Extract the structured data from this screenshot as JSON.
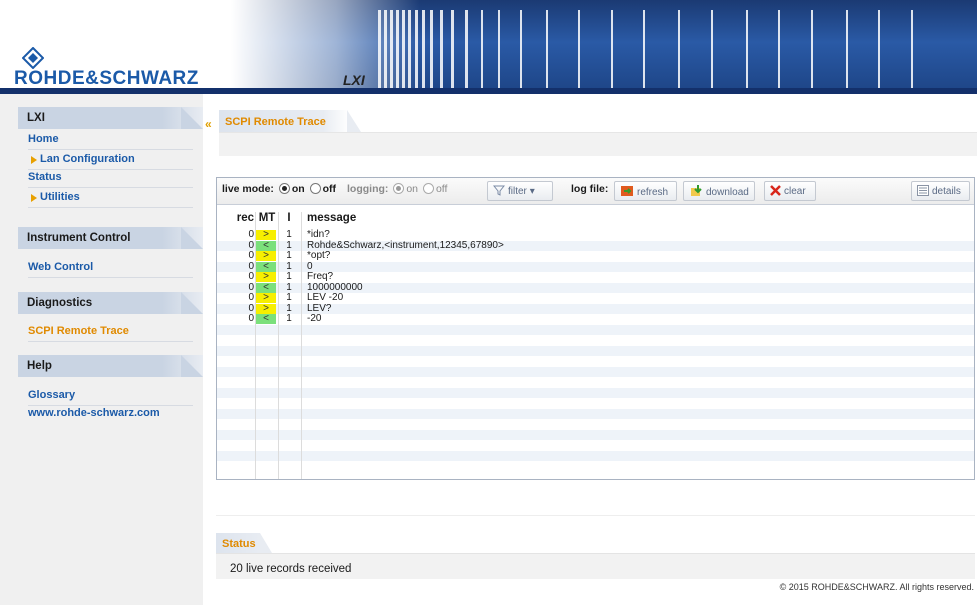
{
  "header": {
    "brand": "ROHDE&SCHWARZ",
    "lxi_logo": "LXI"
  },
  "sidebar": {
    "sections": [
      {
        "title": "LXI",
        "items": [
          {
            "label": "Home",
            "arrow": false,
            "active": false
          },
          {
            "label": "Lan Configuration",
            "arrow": true,
            "active": false
          },
          {
            "label": "Status",
            "arrow": false,
            "active": false
          },
          {
            "label": "Utilities",
            "arrow": true,
            "active": false
          }
        ]
      },
      {
        "title": "Instrument Control",
        "items": [
          {
            "label": "Web Control",
            "arrow": false,
            "active": false
          }
        ]
      },
      {
        "title": "Diagnostics",
        "items": [
          {
            "label": "SCPI Remote Trace",
            "arrow": false,
            "active": true
          }
        ]
      },
      {
        "title": "Help",
        "items": [
          {
            "label": "Glossary",
            "arrow": false,
            "active": false
          },
          {
            "label": "www.rohde-schwarz.com",
            "arrow": false,
            "active": false
          }
        ]
      }
    ]
  },
  "main": {
    "tab_title": "SCPI Remote Trace",
    "toolbar": {
      "live_mode_label": "live mode:",
      "on_label": "on",
      "off_label": "off",
      "live_mode_value": "on",
      "logging_label": "logging:",
      "logging_value": "on",
      "filter_label": "filter",
      "log_file_label": "log file:",
      "refresh_label": "refresh",
      "download_label": "download",
      "clear_label": "clear",
      "details_label": "details"
    },
    "columns": [
      "rec",
      "MT",
      "I",
      "message"
    ],
    "rows": [
      {
        "rec": "0",
        "mt": ">",
        "l": "1",
        "message": "*idn?"
      },
      {
        "rec": "0",
        "mt": "<",
        "l": "1",
        "message": "Rohde&Schwarz,<instrument,12345,67890>"
      },
      {
        "rec": "0",
        "mt": ">",
        "l": "1",
        "message": "*opt?"
      },
      {
        "rec": "0",
        "mt": "<",
        "l": "1",
        "message": "0"
      },
      {
        "rec": "0",
        "mt": ">",
        "l": "1",
        "message": "Freq?"
      },
      {
        "rec": "0",
        "mt": "<",
        "l": "1",
        "message": "1000000000"
      },
      {
        "rec": "0",
        "mt": ">",
        "l": "1",
        "message": "LEV -20"
      },
      {
        "rec": "0",
        "mt": ">",
        "l": "1",
        "message": "LEV?"
      },
      {
        "rec": "0",
        "mt": "<",
        "l": "1",
        "message": "-20"
      }
    ],
    "colors": {
      "send": "#f7ef00",
      "receive": "#7be07b",
      "accent": "#e08a00",
      "link": "#1b5aa8"
    }
  },
  "status": {
    "title": "Status",
    "text": "20 live records received"
  },
  "footer": {
    "copyright": "© 2015 ROHDE&SCHWARZ. All rights reserved."
  }
}
